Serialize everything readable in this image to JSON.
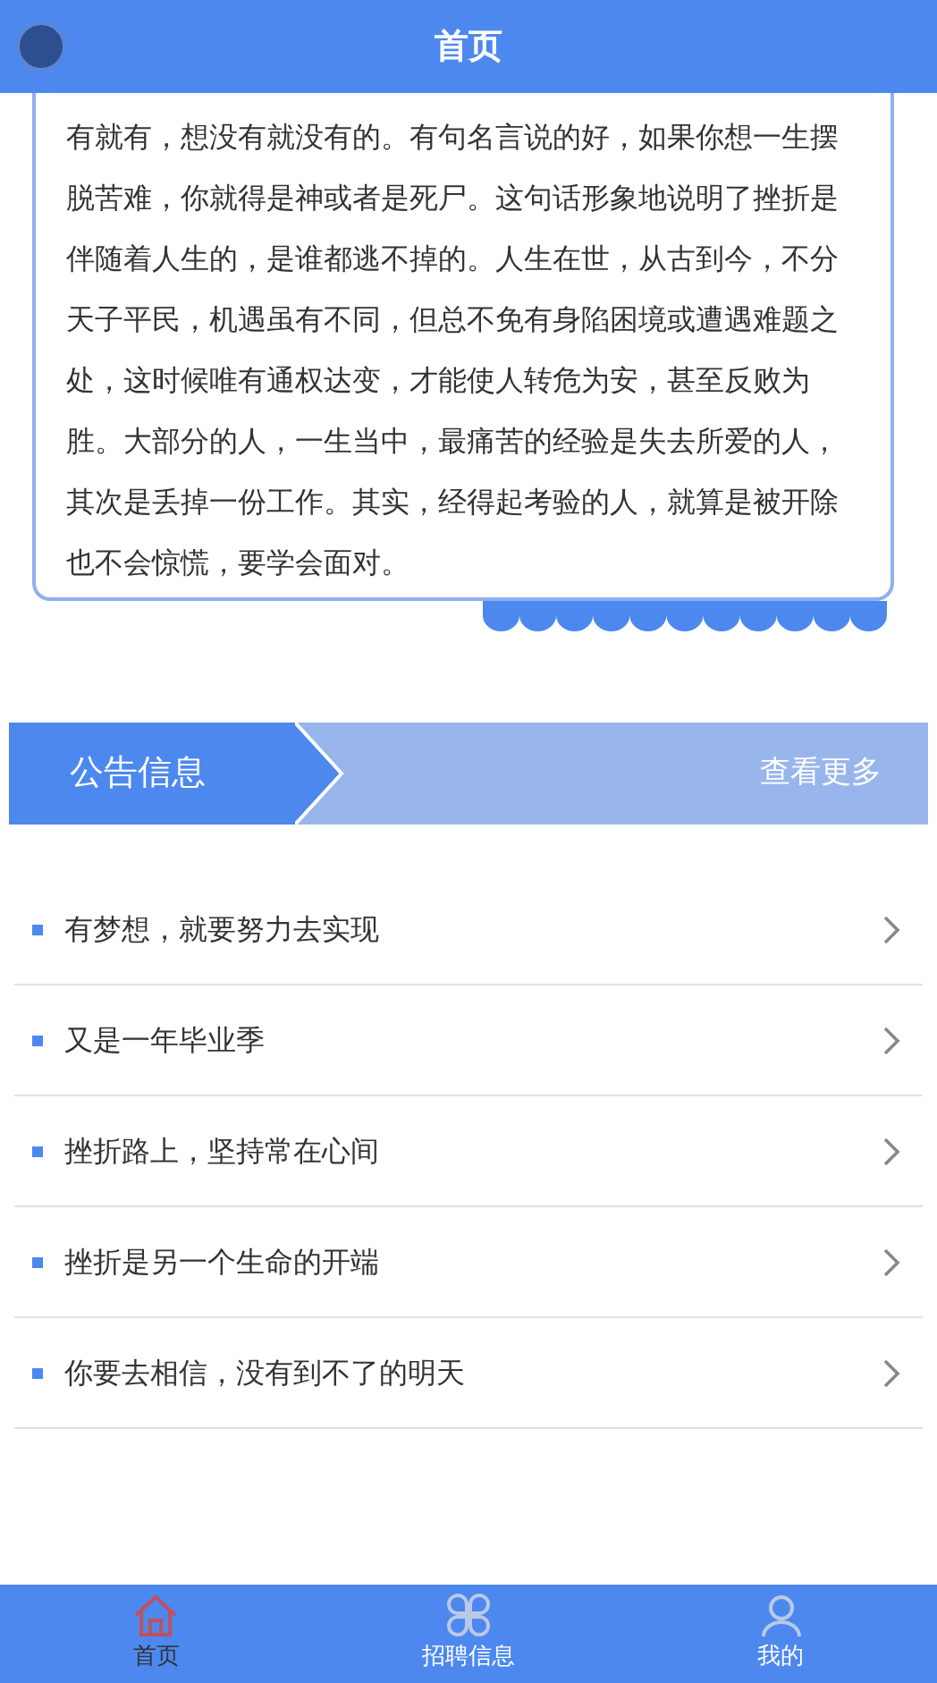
{
  "header": {
    "title": "首页"
  },
  "article": {
    "text": "有就有，想没有就没有的。有句名言说的好，如果你想一生摆脱苦难，你就得是神或者是死尸。这句话形象地说明了挫折是伴随着人生的，是谁都逃不掉的。人生在世，从古到今，不分天子平民，机遇虽有不同，但总不免有身陷困境或遭遇难题之处，这时候唯有通权达变，才能使人转危为安，甚至反败为胜。大部分的人，一生当中，最痛苦的经验是失去所爱的人，其次是丢掉一份工作。其实，经得起考验的人，就算是被开除也不会惊慌，要学会面对。"
  },
  "notice_banner": {
    "title": "公告信息",
    "more": "查看更多"
  },
  "notices": [
    {
      "title": "有梦想，就要努力去实现"
    },
    {
      "title": "又是一年毕业季"
    },
    {
      "title": "挫折路上，坚持常在心间"
    },
    {
      "title": "挫折是另一个生命的开端"
    },
    {
      "title": "你要去相信，没有到不了的明天"
    }
  ],
  "tab_bar": [
    {
      "label": "首页",
      "kind": "home",
      "selected": true
    },
    {
      "label": "招聘信息",
      "kind": "grid",
      "selected": false
    },
    {
      "label": "我的",
      "kind": "user",
      "selected": false
    }
  ]
}
